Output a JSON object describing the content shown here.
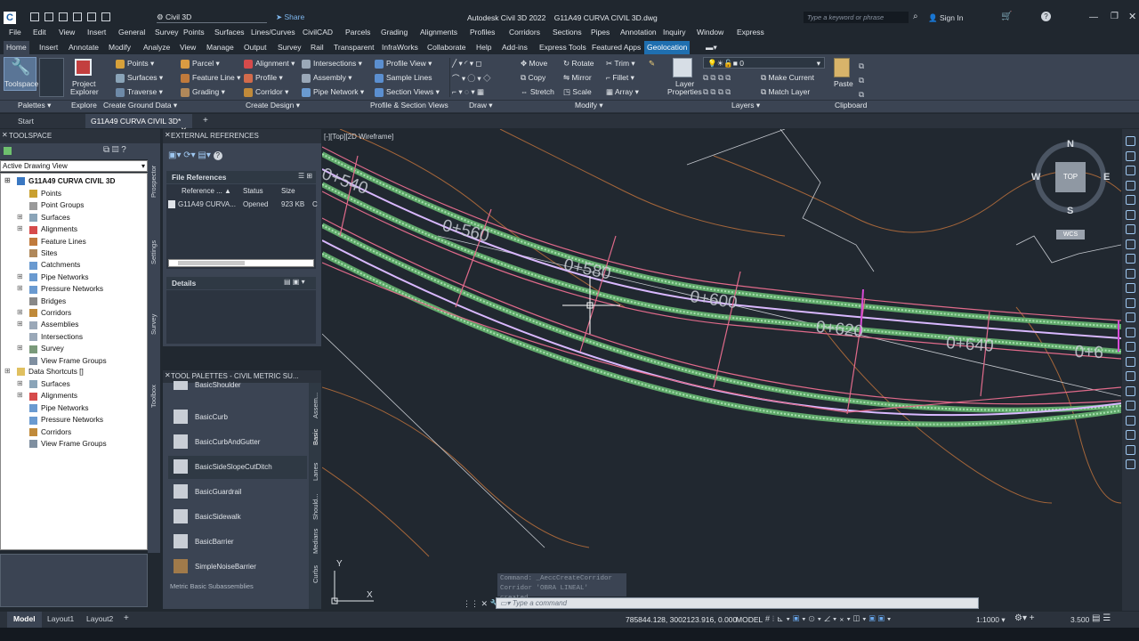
{
  "app": {
    "workspace": "Civil 3D",
    "share": "Share",
    "title": "Autodesk Civil 3D 2022    G11A49 CURVA CIVIL 3D.dwg",
    "search_placeholder": "Type a keyword or phrase",
    "sign_in": "Sign In"
  },
  "menu": [
    "File",
    "Edit",
    "View",
    "Insert",
    "General",
    "Survey",
    "Points",
    "Surfaces",
    "Lines/Curves",
    "CivilCAD",
    "Parcels",
    "Grading",
    "Alignments",
    "Profiles",
    "Corridors",
    "Sections",
    "Pipes",
    "Annotation",
    "Inquiry",
    "Window",
    "Express"
  ],
  "ribbon_tabs": [
    "Home",
    "Insert",
    "Annotate",
    "Modify",
    "Analyze",
    "View",
    "Manage",
    "Output",
    "Survey",
    "Rail",
    "Transparent",
    "InfraWorks",
    "Collaborate",
    "Help",
    "Add-ins",
    "Express Tools",
    "Featured Apps",
    "Geolocation"
  ],
  "ribbon": {
    "toolspace": "Toolspace",
    "project_explorer_1": "Project",
    "project_explorer_2": "Explorer",
    "points": "Points",
    "surfaces": "Surfaces",
    "traverse": "Traverse",
    "parcel": "Parcel",
    "feature_line": "Feature Line",
    "grading": "Grading",
    "alignment": "Alignment",
    "profile": "Profile",
    "corridor": "Corridor",
    "intersections": "Intersections",
    "assembly": "Assembly",
    "pipe_network": "Pipe Network",
    "profile_view": "Profile View",
    "sample_lines": "Sample Lines",
    "section_views": "Section Views",
    "move": "Move",
    "copy": "Copy",
    "stretch": "Stretch",
    "rotate": "Rotate",
    "mirror": "Mirror",
    "scale": "Scale",
    "trim": "Trim",
    "fillet": "Fillet",
    "array": "Array",
    "layer_props_1": "Layer",
    "layer_props_2": "Properties",
    "layer_value": "0",
    "make_current": "Make Current",
    "match_layer": "Match Layer",
    "paste": "Paste",
    "panels": {
      "palettes": "Palettes",
      "explore": "Explore",
      "create_ground": "Create Ground Data",
      "create_design": "Create Design",
      "profile_section": "Profile & Section Views",
      "draw": "Draw",
      "modify": "Modify",
      "layers": "Layers",
      "clipboard": "Clipboard"
    }
  },
  "file_tabs": {
    "start": "Start",
    "drawing": "G11A49 CURVA CIVIL 3D*"
  },
  "toolspace": {
    "header": "TOOLSPACE",
    "view": "Active Drawing View",
    "root": "G11A49 CURVA CIVIL 3D",
    "items": [
      "Points",
      "Point Groups",
      "Surfaces",
      "Alignments",
      "Feature Lines",
      "Sites",
      "Catchments",
      "Pipe Networks",
      "Pressure Networks",
      "Bridges",
      "Corridors",
      "Assemblies",
      "Intersections",
      "Survey",
      "View Frame Groups"
    ],
    "shortcuts_root": "Data Shortcuts []",
    "shortcuts": [
      "Surfaces",
      "Alignments",
      "Pipe Networks",
      "Pressure Networks",
      "Corridors",
      "View Frame Groups"
    ],
    "side_tabs": [
      "Prospector",
      "Settings",
      "Survey",
      "Toolbox"
    ]
  },
  "xref": {
    "header": "EXTERNAL REFERENCES",
    "file_refs": "File References",
    "cols": [
      "Reference ...",
      "Status",
      "Size"
    ],
    "row": [
      "G11A49 CURVA...",
      "Opened",
      "923 KB",
      "C"
    ],
    "details": "Details"
  },
  "palette": {
    "header": "TOOL PALETTES - CIVIL METRIC SU...",
    "items": [
      "BasicShoulder",
      "BasicCurb",
      "BasicCurbAndGutter",
      "BasicSideSlopeCutDitch",
      "BasicGuardrail",
      "BasicSidewalk",
      "BasicBarrier",
      "SimpleNoiseBarrier"
    ],
    "footer": "Metric Basic Subassemblies",
    "tabs": [
      "Assem...",
      "Basic",
      "Lanes",
      "Should...",
      "Medians",
      "Curbs"
    ]
  },
  "viewport": {
    "label": "[-][Top][2D Wireframe]",
    "stations": [
      "0+540",
      "0+560",
      "0+580",
      "0+600",
      "0+620",
      "0+640",
      "0+6"
    ],
    "viewcube_top": "TOP",
    "north": "N",
    "south": "S",
    "east": "E",
    "west": "W",
    "wcs": "WCS",
    "ucs_x": "X",
    "ucs_y": "Y"
  },
  "command": {
    "line1": "Command: _AeccCreateCorridor",
    "line2": "Corridor 'OBRA LINEAL' created.",
    "placeholder": "Type a command"
  },
  "status": {
    "coords": "785844.128, 3002123.916, 0.000",
    "model": "MODEL",
    "scale": "1:1000",
    "units": "3.500"
  },
  "layout_tabs": [
    "Model",
    "Layout1",
    "Layout2"
  ],
  "colors": {
    "geolocation": "#1f6fb0",
    "alignment": "#d9b8ff",
    "corridor_green": "#5fa86a",
    "right_of_way": "#e06a8a",
    "contour": "#a5663a"
  }
}
